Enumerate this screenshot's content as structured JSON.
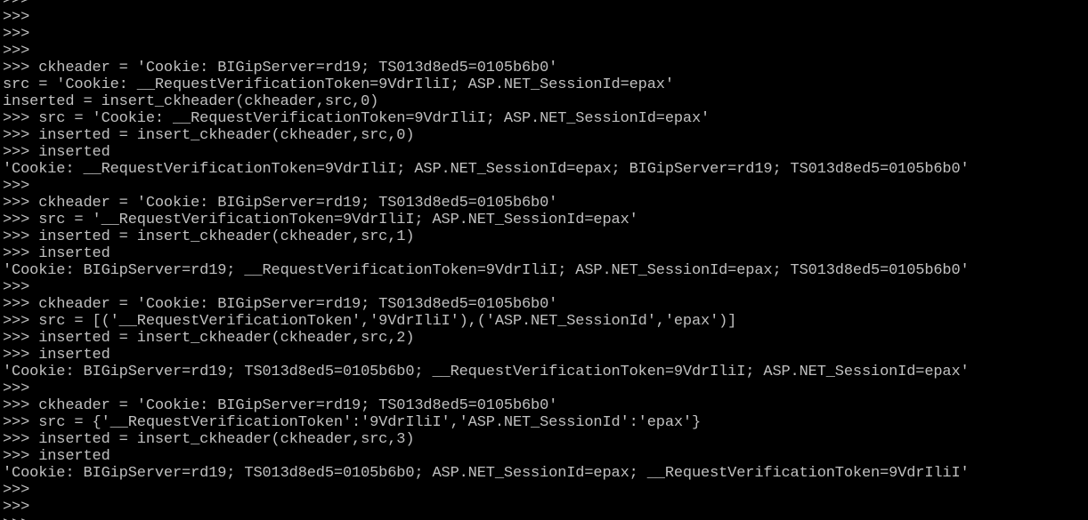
{
  "terminal": {
    "colors": {
      "background": "#000000",
      "text": "#c0c0c0"
    },
    "lines": [
      ">>>",
      ">>>",
      ">>>",
      ">>>",
      ">>> ckheader = 'Cookie: BIGipServer=rd19; TS013d8ed5=0105b6b0'",
      "src = 'Cookie: __RequestVerificationToken=9VdrIliI; ASP.NET_SessionId=epax'",
      "inserted = insert_ckheader(ckheader,src,0)",
      ">>> src = 'Cookie: __RequestVerificationToken=9VdrIliI; ASP.NET_SessionId=epax'",
      ">>> inserted = insert_ckheader(ckheader,src,0)",
      ">>> inserted",
      "'Cookie: __RequestVerificationToken=9VdrIliI; ASP.NET_SessionId=epax; BIGipServer=rd19; TS013d8ed5=0105b6b0'",
      ">>>",
      ">>> ckheader = 'Cookie: BIGipServer=rd19; TS013d8ed5=0105b6b0'",
      ">>> src = '__RequestVerificationToken=9VdrIliI; ASP.NET_SessionId=epax'",
      ">>> inserted = insert_ckheader(ckheader,src,1)",
      ">>> inserted",
      "'Cookie: BIGipServer=rd19; __RequestVerificationToken=9VdrIliI; ASP.NET_SessionId=epax; TS013d8ed5=0105b6b0'",
      ">>>",
      ">>> ckheader = 'Cookie: BIGipServer=rd19; TS013d8ed5=0105b6b0'",
      ">>> src = [('__RequestVerificationToken','9VdrIliI'),('ASP.NET_SessionId','epax')]",
      ">>> inserted = insert_ckheader(ckheader,src,2)",
      ">>> inserted",
      "'Cookie: BIGipServer=rd19; TS013d8ed5=0105b6b0; __RequestVerificationToken=9VdrIliI; ASP.NET_SessionId=epax'",
      ">>>",
      ">>> ckheader = 'Cookie: BIGipServer=rd19; TS013d8ed5=0105b6b0'",
      ">>> src = {'__RequestVerificationToken':'9VdrIliI','ASP.NET_SessionId':'epax'}",
      ">>> inserted = insert_ckheader(ckheader,src,3)",
      ">>> inserted",
      "'Cookie: BIGipServer=rd19; TS013d8ed5=0105b6b0; ASP.NET_SessionId=epax; __RequestVerificationToken=9VdrIliI'",
      ">>>",
      ">>>",
      ">>>"
    ]
  }
}
